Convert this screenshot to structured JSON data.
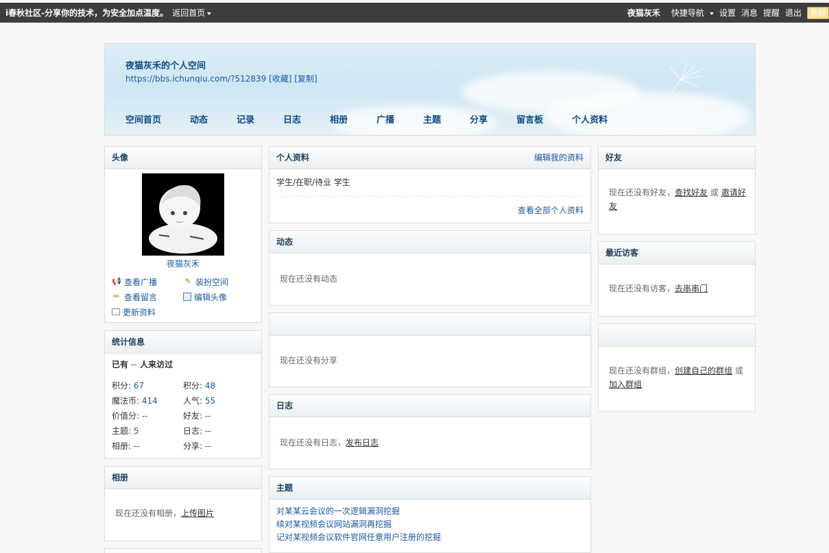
{
  "topbar": {
    "site_title": "i春秋社区-分享你的技术，为安全加点温度。",
    "back_home": "返回首页",
    "username": "夜猫灰禾",
    "quick_nav": "快捷导航",
    "settings": "设置",
    "messages": "消息",
    "reminders": "提醒",
    "logout": "退出",
    "decorate_badge": "装扮"
  },
  "banner": {
    "title": "夜猫灰禾的个人空间",
    "url": "https://bbs.ichunqiu.com/?512839",
    "favorite": "[收藏]",
    "copy": "[复制]",
    "nav": [
      "空间首页",
      "动态",
      "记录",
      "日志",
      "相册",
      "广播",
      "主题",
      "分享",
      "留言板",
      "个人资料"
    ]
  },
  "avatar_box": {
    "title": "头像",
    "name": "夜猫灰禾",
    "links": {
      "view_broadcast": "查看广播",
      "decorate_space": "装扮空间",
      "view_messages": "查看留言",
      "edit_avatar": "编辑头像",
      "update_profile": "更新资料"
    }
  },
  "stats_box": {
    "title": "统计信息",
    "visits_prefix": "已有",
    "visits_value": "--",
    "visits_suffix": "人来访过",
    "items": [
      {
        "label": "积分:",
        "value": "67"
      },
      {
        "label": "积分:",
        "value": "48"
      },
      {
        "label": "魔法币:",
        "value": "414"
      },
      {
        "label": "人气:",
        "value": "55"
      },
      {
        "label": "价值分:",
        "value": "--"
      },
      {
        "label": "好友:",
        "value": "--"
      },
      {
        "label": "主题:",
        "value": "5"
      },
      {
        "label": "日志:",
        "value": "--"
      },
      {
        "label": "相册:",
        "value": "--"
      },
      {
        "label": "分享:",
        "value": "--"
      }
    ]
  },
  "album_box": {
    "title": "相册",
    "empty_text": "现在还没有相册，",
    "upload_link": "上传图片"
  },
  "profile_box": {
    "title": "个人资料",
    "edit_link": "编辑我的资料",
    "content": "学生/在职/待业  学生",
    "view_all_link": "查看全部个人资料"
  },
  "feed_box": {
    "title": "动态",
    "empty_text": "现在还没有动态"
  },
  "share_box": {
    "title": "",
    "empty_text": "现在还没有分享"
  },
  "blog_box": {
    "title": "日志",
    "empty_text": "现在还没有日志，",
    "publish_link": "发布日志"
  },
  "threads_box": {
    "title": "主题",
    "items": [
      "对某某云会议的一次逻辑漏洞挖掘",
      "续对某视频会议网站漏洞再挖掘",
      "记对某视频会议软件官网任意用户注册的挖掘"
    ]
  },
  "friends_box": {
    "title": "好友",
    "empty_text": "现在还没有好友，",
    "find_link": "查找好友",
    "or_text": "或",
    "invite_link": "邀请好友"
  },
  "visitors_box": {
    "title": "最近访客",
    "empty_text": "现在还没有访客，",
    "visit_link": "去串串门"
  },
  "groups_box": {
    "title": "",
    "empty_text": "现在还没有群组，",
    "create_link": "创建自己的群组",
    "or_text": "或",
    "join_link": "加入群组"
  },
  "colors": {
    "topbar_bg": "#3d3d3d",
    "link_blue": "#1a5aa0",
    "heading_blue": "#0c4b85"
  }
}
